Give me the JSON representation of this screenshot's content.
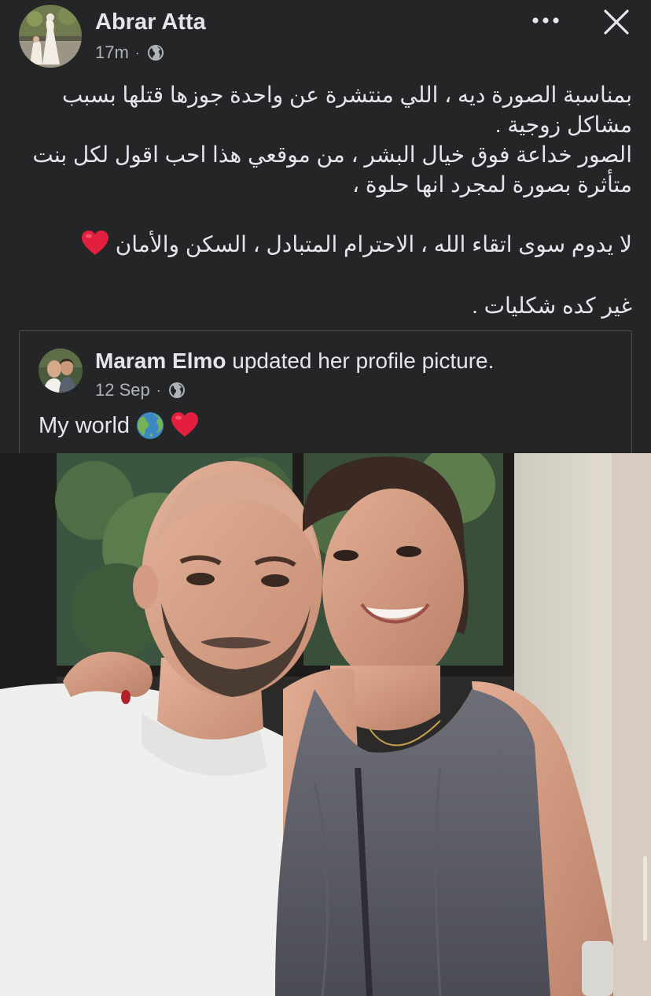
{
  "post": {
    "author": "Abrar Atta",
    "time": "17m",
    "separator": "·",
    "privacy_icon": "globe-icon",
    "more_icon": "more-horizontal-icon",
    "close_icon": "close-icon",
    "text_lines": [
      "بمناسبة الصورة ديه ، اللي منتشرة عن واحدة جوزها قتلها بسبب",
      "مشاكل زوجية .",
      "الصور خداعة فوق خيال البشر ، من موقعي هذا احب اقول لكل بنت",
      "متأثرة بصورة لمجرد انها حلوة ،",
      "لا يدوم سوى اتقاء الله ، الاحترام المتبادل ، السكن والأمان",
      "غير كده شكليات ."
    ],
    "heart_emoji": "heart-emoji"
  },
  "shared": {
    "author": "Maram Elmo",
    "action": "updated her profile picture.",
    "date": "12 Sep",
    "separator": "·",
    "privacy_icon": "globe-icon",
    "caption": "My world",
    "caption_emojis": [
      "earth-globe-emoji",
      "heart-emoji"
    ]
  },
  "colors": {
    "background": "#242526",
    "primary_text": "#e4e6eb",
    "secondary_text": "#b0b3b8",
    "card_border": "#4b4c4f",
    "heart_red": "#e41e3f"
  }
}
